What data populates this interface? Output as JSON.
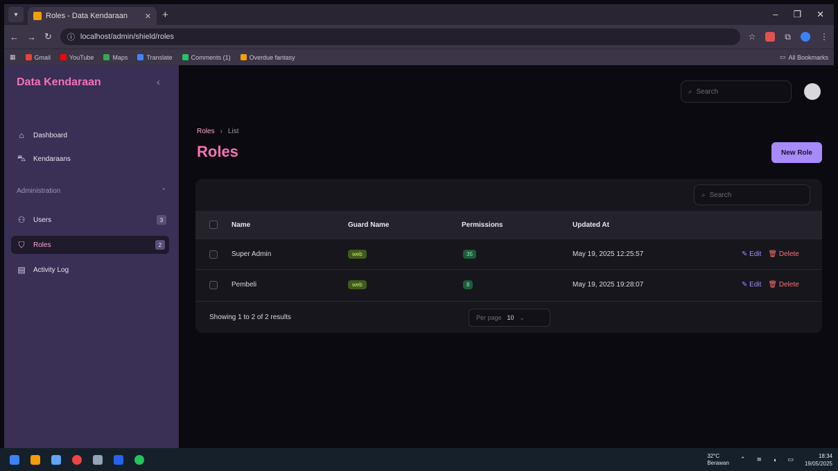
{
  "browser": {
    "tab_title": "Roles - Data Kendaraan",
    "url": "localhost/admin/shield/roles",
    "bookmarks": [
      {
        "label": "Gmail",
        "color": "#ea4335"
      },
      {
        "label": "YouTube",
        "color": "#ff0000"
      },
      {
        "label": "Maps",
        "color": "#34a853"
      },
      {
        "label": "Translate",
        "color": "#4285f4"
      },
      {
        "label": "Comments (1)",
        "color": "#22c55e"
      },
      {
        "label": "Overdue fantasy",
        "color": "#f59e0b"
      }
    ],
    "all_bookmarks": "All Bookmarks"
  },
  "sidebar": {
    "brand": "Data Kendaraan",
    "items": [
      {
        "label": "Dashboard",
        "icon": "home-icon"
      },
      {
        "label": "Kendaraans",
        "icon": "car-icon"
      }
    ],
    "group_label": "Administration",
    "admin_items": [
      {
        "label": "Users",
        "badge": "3",
        "icon": "users-icon"
      },
      {
        "label": "Roles",
        "badge": "2",
        "icon": "shield-icon"
      },
      {
        "label": "Activity Log",
        "icon": "log-icon"
      }
    ]
  },
  "header": {
    "search_placeholder": "Search"
  },
  "main": {
    "breadcrumb": [
      "Roles",
      "List"
    ],
    "title": "Roles",
    "new_button": "New Role",
    "table_search_placeholder": "Search",
    "columns": [
      "Name",
      "Guard Name",
      "Permissions",
      "Updated At"
    ],
    "rows": [
      {
        "name": "Super Admin",
        "guard": "web",
        "permissions": "35",
        "updated": "May 19, 2025 12:25:57",
        "edit": "Edit",
        "delete": "Delete"
      },
      {
        "name": "Pembeli",
        "guard": "web",
        "permissions": "8",
        "updated": "May 19, 2025 19:28:07",
        "edit": "Edit",
        "delete": "Delete"
      }
    ],
    "footer_text": "Showing 1 to 2 of 2 results",
    "per_page_label": "Per page",
    "per_page_value": "10"
  },
  "taskbar": {
    "weather_temp": "32°C",
    "weather_desc": "Berawan",
    "time": "18:34",
    "date": "19/05/2025"
  },
  "colors": {
    "accent_pink": "#f472b6",
    "button_purple": "#a78bfa",
    "sidebar_bg": "#3a2f55"
  }
}
